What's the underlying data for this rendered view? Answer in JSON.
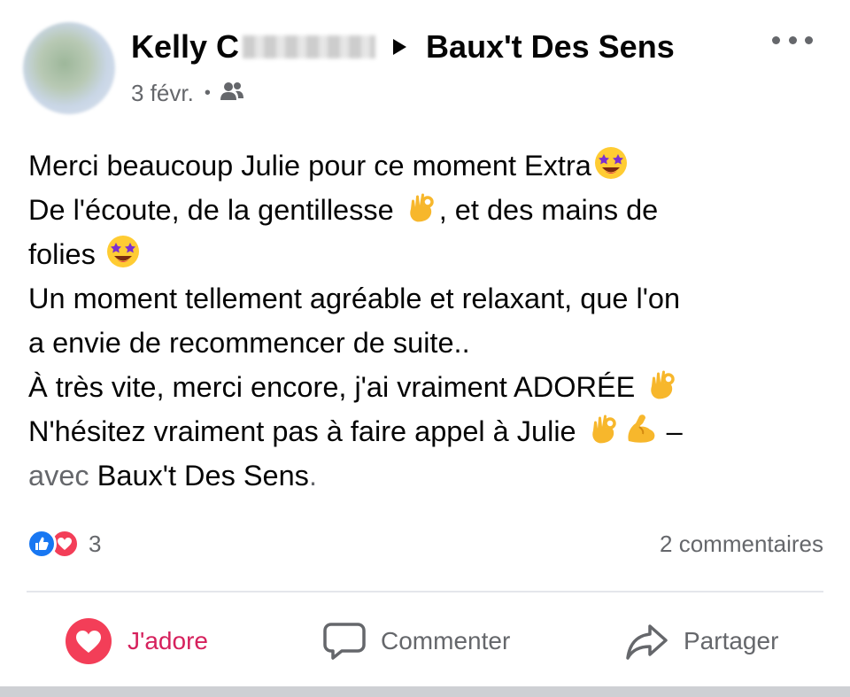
{
  "post": {
    "author": "Kelly C",
    "target_page": "Baux't Des Sens",
    "date": "3 févr.",
    "audience_icon": "friends-icon",
    "more_icon": "more-horizontal-icon",
    "lines": [
      {
        "text": "Merci beaucoup Julie pour ce moment Extra",
        "emojis": [
          "star-struck"
        ]
      },
      {
        "text": "De l'écoute, de la gentillesse ",
        "emojis": [
          "ok-hand"
        ],
        "after": ", et des mains de"
      },
      {
        "text": "folies ",
        "emojis": [
          "star-struck"
        ]
      },
      {
        "text": "Un moment tellement agréable et relaxant, que l'on"
      },
      {
        "text": "a envie de recommencer de suite.."
      },
      {
        "text": "À très vite, merci encore, j'ai vraiment ADORÉE ",
        "emojis": [
          "ok-hand"
        ]
      },
      {
        "text": "N'hésitez vraiment pas à faire appel à Julie ",
        "emojis": [
          "ok-hand",
          "flexed-biceps"
        ],
        "after": " –"
      }
    ],
    "with_prefix": "avec ",
    "with_page": "Baux't Des Sens",
    "with_suffix": "."
  },
  "reactions": {
    "types": [
      "like-icon",
      "love-icon"
    ],
    "count": "3",
    "comments": "2 commentaires"
  },
  "actions": {
    "adore_label": "J'adore",
    "comment_label": "Commenter",
    "share_label": "Partager"
  },
  "colors": {
    "text": "#050505",
    "muted": "#65676b",
    "like_blue": "#1877f2",
    "love_red": "#f33e58",
    "adore_active": "#d6215d"
  }
}
